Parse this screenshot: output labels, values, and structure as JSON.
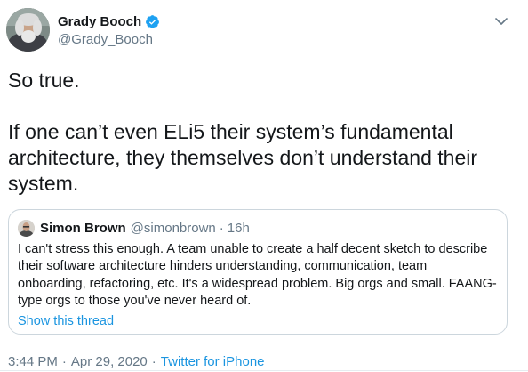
{
  "author": {
    "display_name": "Grady Booch",
    "handle": "@Grady_Booch",
    "verified": true,
    "avatar_icon": "avatar-photo-icon"
  },
  "tweet": {
    "paragraphs": [
      "So true.",
      "If one can’t even ELi5 their system’s fundamental architecture, they themselves don’t understand their system."
    ]
  },
  "quoted_tweet": {
    "display_name": "Simon Brown",
    "handle": "@simonbrown",
    "separator": "·",
    "relative_time": "16h",
    "text": "I can't stress this enough. A team unable to create a half decent sketch to describe their software architecture hinders understanding, communication, team onboarding, refactoring, etc. It's a widespread problem. Big orgs and small. FAANG-type orgs to those you've never heard of.",
    "show_thread_label": "Show this thread"
  },
  "meta": {
    "time": "3:44 PM",
    "separator": "·",
    "date": "Apr 29, 2020",
    "source": "Twitter for iPhone"
  },
  "colors": {
    "text_primary": "#14171a",
    "text_secondary": "#657786",
    "link": "#1b95e0",
    "verified_badge": "#1da1f2",
    "border": "#ccd6dd"
  }
}
